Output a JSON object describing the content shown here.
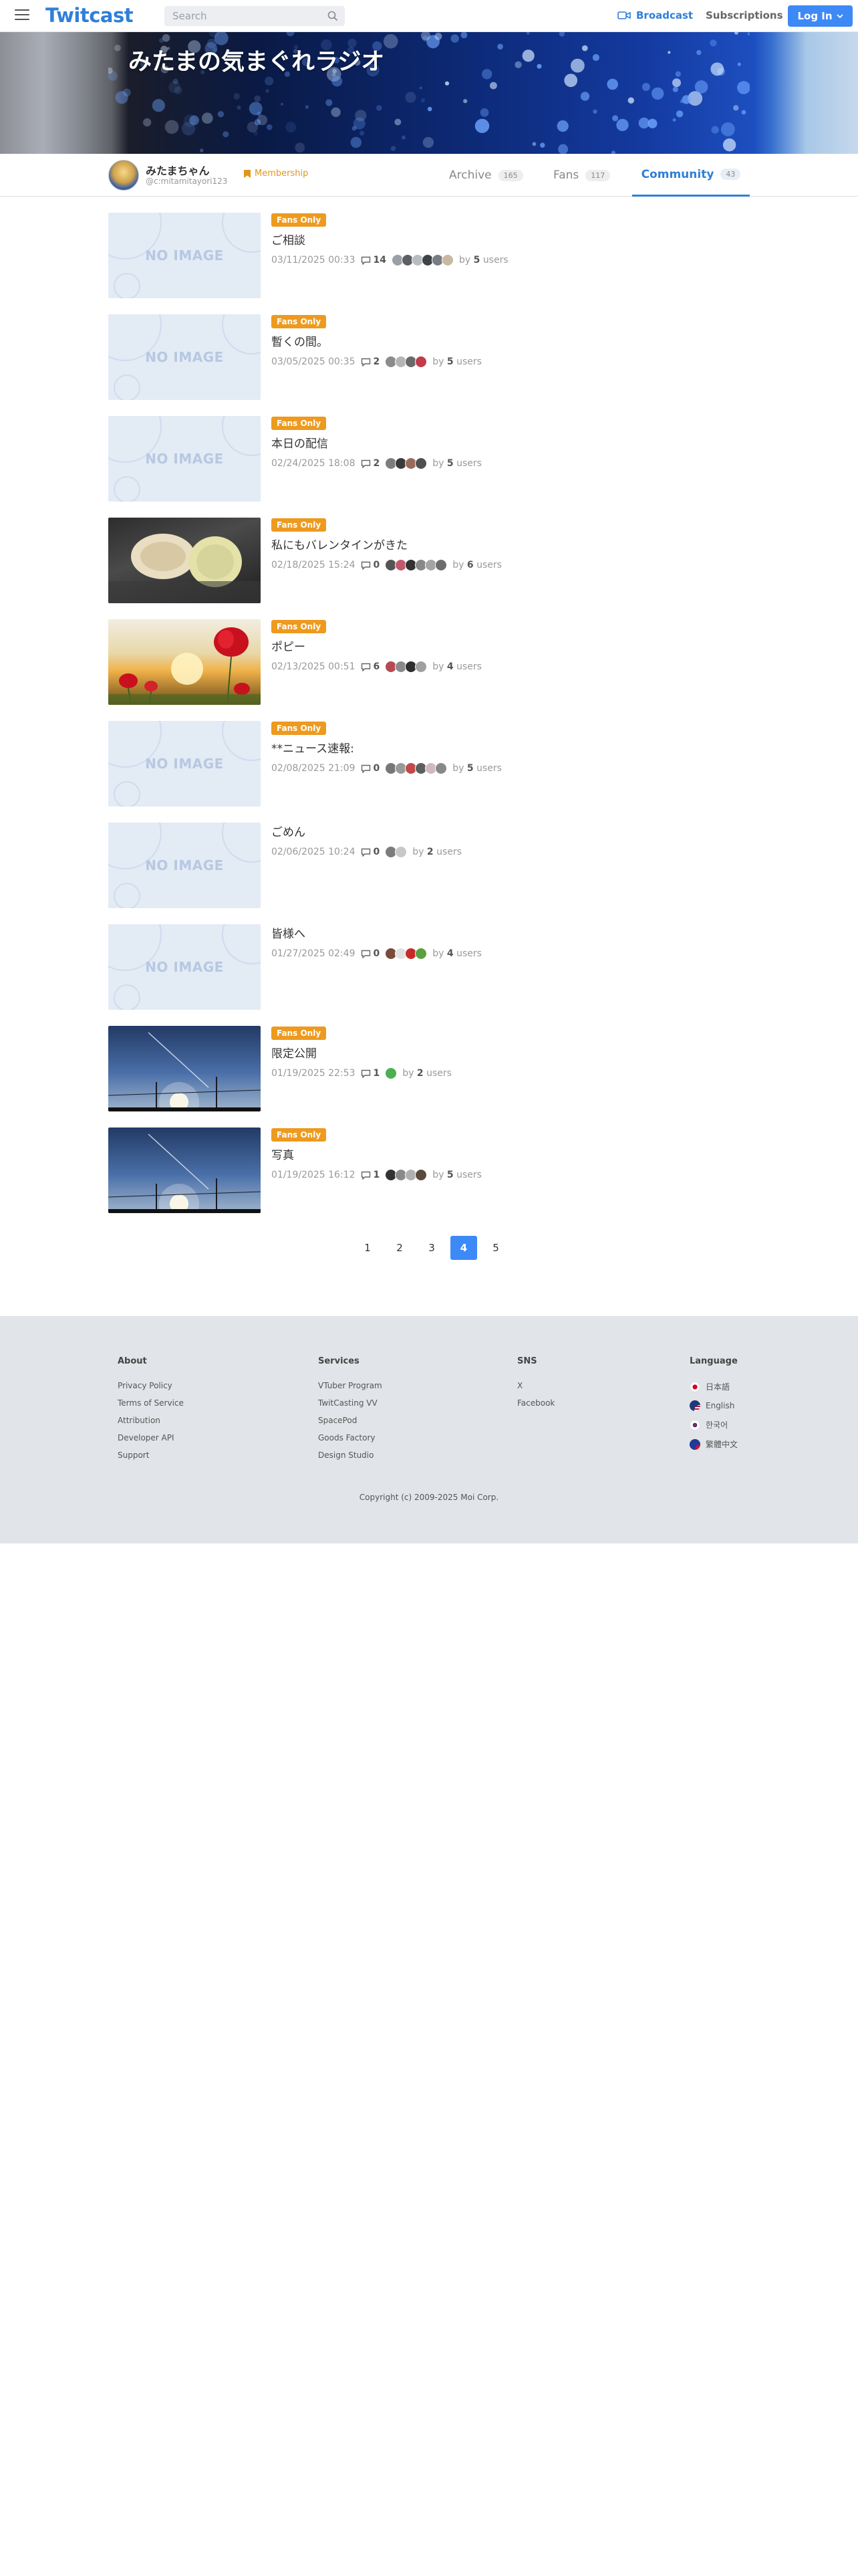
{
  "header": {
    "logo": "Twitcast",
    "search_placeholder": "Search",
    "broadcast": "Broadcast",
    "subscriptions": "Subscriptions",
    "login": "Log In"
  },
  "banner": {
    "title": "みたまの気まぐれラジオ"
  },
  "profile": {
    "name": "みたまちゃん",
    "handle": "@c:mitamitayori123",
    "membership": "Membership",
    "tabs": [
      {
        "label": "Archive",
        "count": "165"
      },
      {
        "label": "Fans",
        "count": "117"
      },
      {
        "label": "Community",
        "count": "43"
      }
    ]
  },
  "posts": [
    {
      "badge": "Fans Only",
      "title": "ご相談",
      "date": "03/11/2025 00:33",
      "comments": "14",
      "users": "5",
      "thumb": "noimage"
    },
    {
      "badge": "Fans Only",
      "title": "暫くの間。",
      "date": "03/05/2025 00:35",
      "comments": "2",
      "users": "5",
      "thumb": "noimage"
    },
    {
      "badge": "Fans Only",
      "title": "本日の配信",
      "date": "02/24/2025 18:08",
      "comments": "2",
      "users": "5",
      "thumb": "noimage"
    },
    {
      "badge": "Fans Only",
      "title": "私にもバレンタインがきた",
      "date": "02/18/2025 15:24",
      "comments": "0",
      "users": "6",
      "thumb": "photo-valentine"
    },
    {
      "badge": "Fans Only",
      "title": "ポピー",
      "date": "02/13/2025 00:51",
      "comments": "6",
      "users": "4",
      "thumb": "photo-poppy"
    },
    {
      "badge": "Fans Only",
      "title": "**ニュース速報:",
      "date": "02/08/2025 21:09",
      "comments": "0",
      "users": "5",
      "thumb": "noimage"
    },
    {
      "badge": "",
      "title": "ごめん",
      "date": "02/06/2025 10:24",
      "comments": "0",
      "users": "2",
      "thumb": "noimage"
    },
    {
      "badge": "",
      "title": "皆様へ",
      "date": "01/27/2025 02:49",
      "comments": "0",
      "users": "4",
      "thumb": "noimage"
    },
    {
      "badge": "Fans Only",
      "title": "限定公開",
      "date": "01/19/2025 22:53",
      "comments": "1",
      "users": "2",
      "thumb": "photo-sky"
    },
    {
      "badge": "Fans Only",
      "title": "写真",
      "date": "01/19/2025 16:12",
      "comments": "1",
      "users": "5",
      "thumb": "photo-sky"
    }
  ],
  "noimage_label": "NO IMAGE",
  "by_label": "by",
  "users_label": "users",
  "pagination": {
    "pages": [
      "1",
      "2",
      "3",
      "4",
      "5"
    ],
    "current": "4"
  },
  "footer": {
    "about": {
      "title": "About",
      "links": [
        "Privacy Policy",
        "Terms of Service",
        "Attribution",
        "Developer API",
        "Support"
      ]
    },
    "services": {
      "title": "Services",
      "links": [
        "VTuber Program",
        "TwitCasting VV",
        "SpacePod",
        "Goods Factory",
        "Design Studio"
      ]
    },
    "sns": {
      "title": "SNS",
      "links": [
        "X",
        "Facebook"
      ]
    },
    "language": {
      "title": "Language",
      "links": [
        "日本語",
        "English",
        "한국어",
        "繁體中文"
      ]
    },
    "copyright": "Copyright (c) 2009-2025 Moi Corp."
  },
  "colors": {
    "brand": "#2f7fd9",
    "login_bg": "#3d8af7",
    "badge": "#ed9a1f",
    "footer_bg": "#e1e4e8"
  }
}
